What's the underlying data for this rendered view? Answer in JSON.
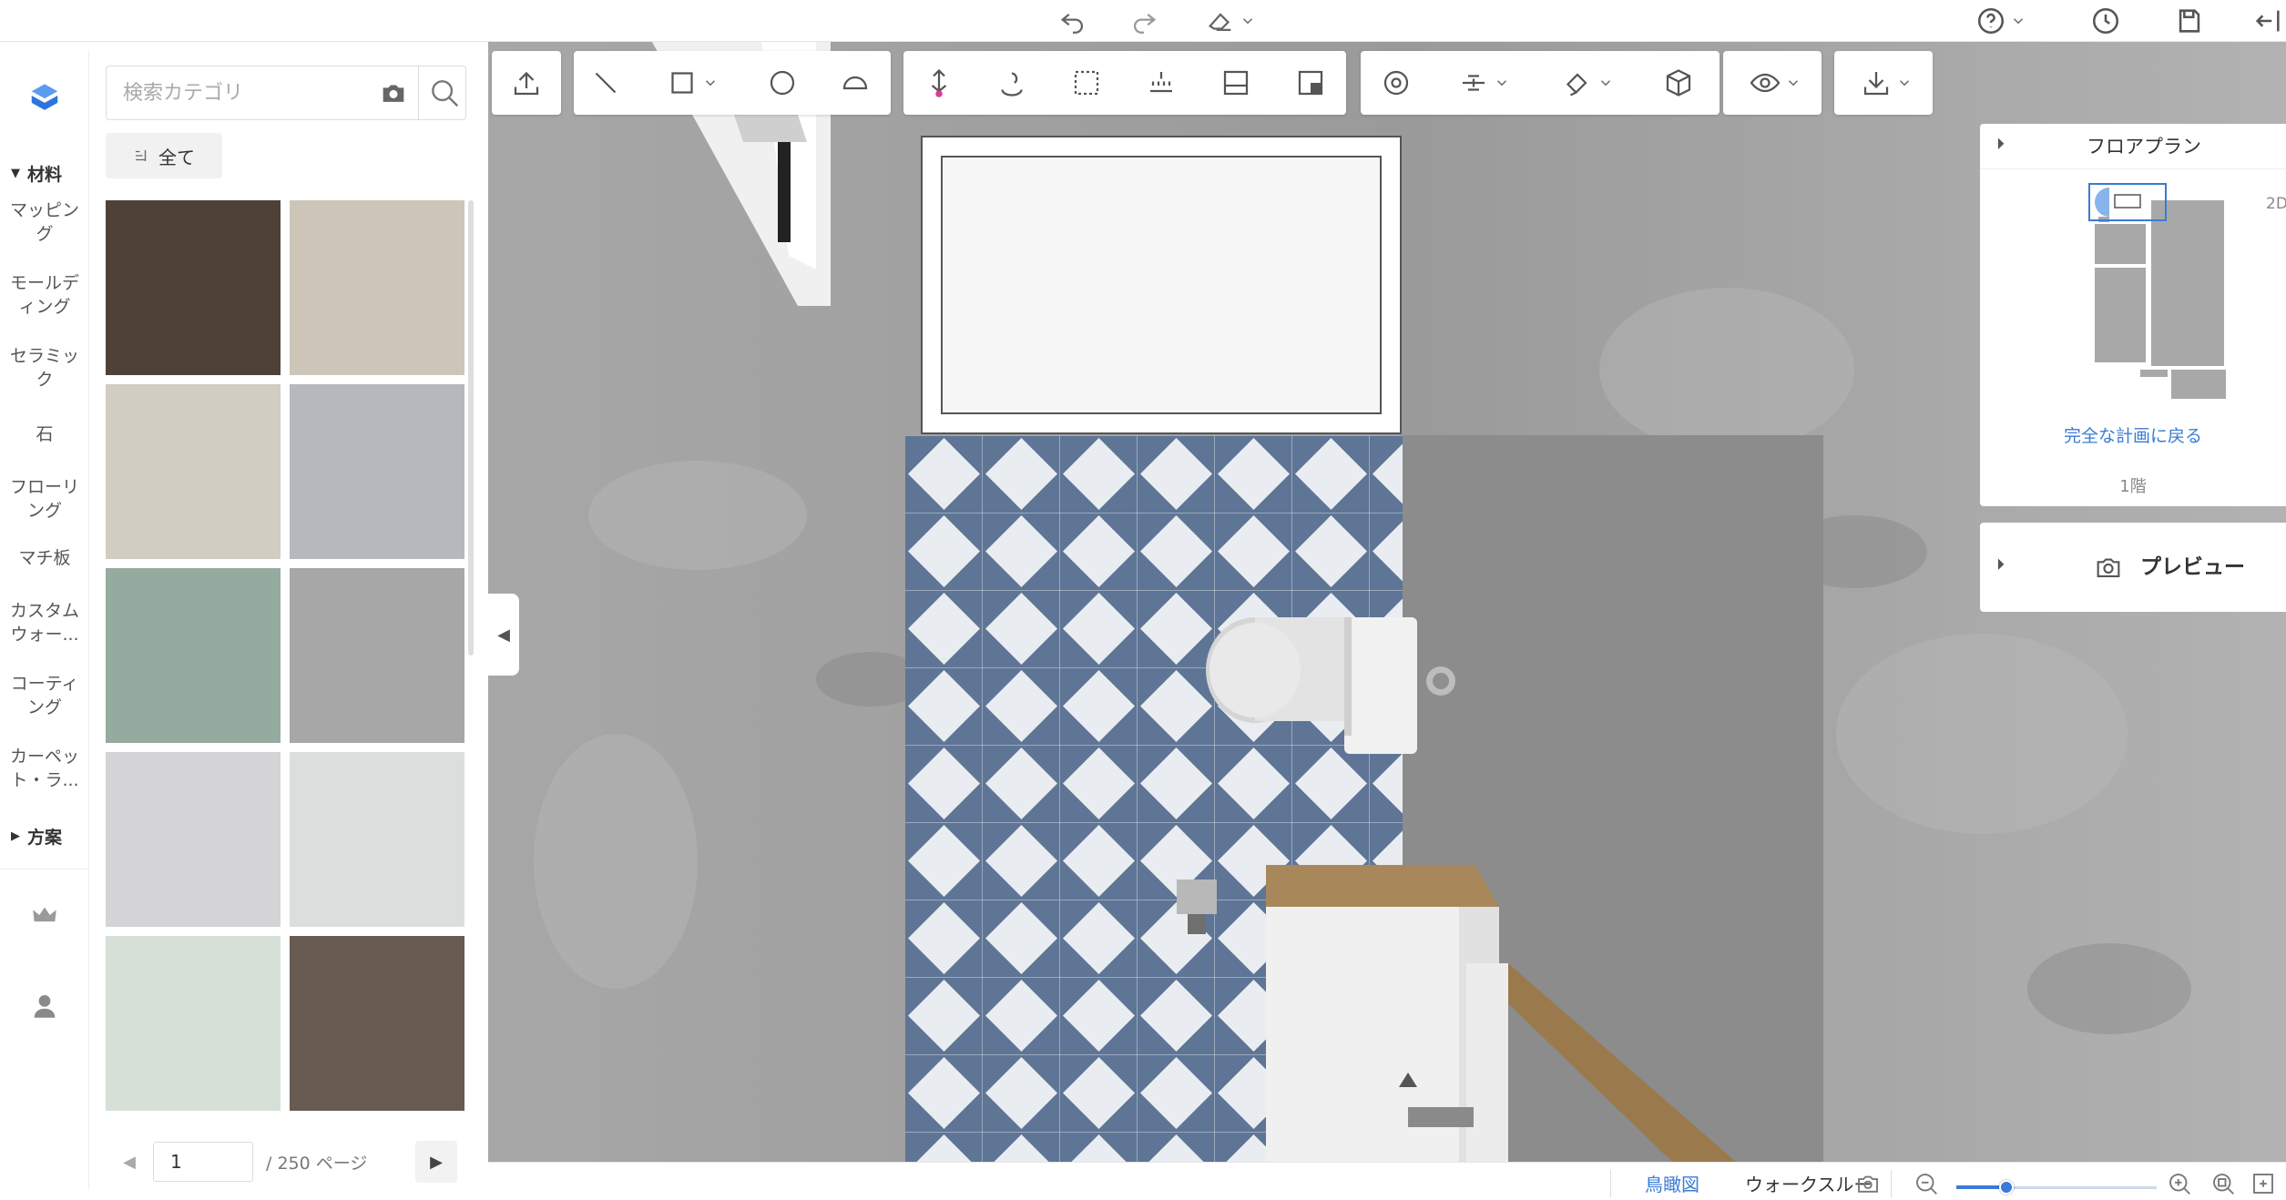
{
  "search": {
    "placeholder": "検索カテゴリ"
  },
  "filter": {
    "label": "全て"
  },
  "rail": {
    "sections": [
      {
        "label": "材料"
      },
      {
        "label": "方案"
      }
    ],
    "items": [
      {
        "label": "マッピング"
      },
      {
        "label": "モールディング"
      },
      {
        "label": "セラミック"
      },
      {
        "label": "石"
      },
      {
        "label": "フローリング"
      },
      {
        "label": "マチ板"
      },
      {
        "label": "カスタムウォー..."
      },
      {
        "label": "コーティング"
      },
      {
        "label": "カーペット・ラ..."
      }
    ]
  },
  "swatches": [
    {
      "color": "#4e4137"
    },
    {
      "color": "#cdc6b8"
    },
    {
      "color": "#d2cdc3"
    },
    {
      "color": "#b6b8bd"
    },
    {
      "color": "#95ab9f"
    },
    {
      "color": "#a8a7a8"
    },
    {
      "color": "#d4d4d6"
    },
    {
      "color": "#dcdede"
    },
    {
      "color": "#d6e0d6"
    },
    {
      "color": "#675a50"
    }
  ],
  "pager": {
    "current": "1",
    "total": "/ 250 ページ",
    "prev": "◀",
    "next": "▶"
  },
  "floorplan": {
    "title": "フロアプラン",
    "back_link": "完全な計画に戻る",
    "level": "1階",
    "mode": "2D"
  },
  "preview": {
    "title": "プレビュー"
  },
  "bottom": {
    "tab_active": "鳥瞰図",
    "tab_walk": "ウォークスルー"
  },
  "colors": {
    "accent": "#3a7bd5",
    "tile_blue": "#5f7595",
    "tile_white": "#e9edf2",
    "wall": "#9e9e9e",
    "wood": "#a8885b"
  },
  "zoom": {
    "level": 0.25
  }
}
